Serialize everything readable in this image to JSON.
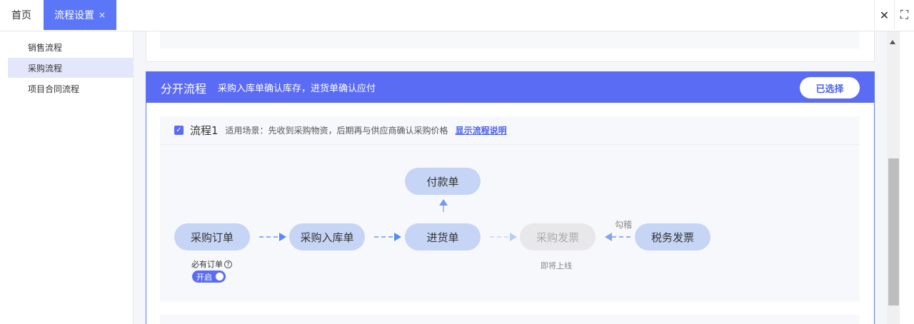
{
  "tabs": {
    "home_label": "首页",
    "active_label": "流程设置",
    "active_close": "×"
  },
  "topbar_icons": [
    "close-icon",
    "fullscreen-icon"
  ],
  "topbar_glyphs": {
    "close": "✕",
    "fullscreen": "⛶"
  },
  "sidebar": {
    "items": [
      {
        "label": "销售流程",
        "active": false
      },
      {
        "label": "采购流程",
        "active": true
      },
      {
        "label": "项目合同流程",
        "active": false
      }
    ]
  },
  "card": {
    "title": "分开流程",
    "subtitle": "采购入库单确认库存，进货单确认应付",
    "selected_button": "已选择"
  },
  "flow": {
    "checkbox_checked": true,
    "checkbox_glyph": "✓",
    "name": "流程1",
    "description": "适用场景：先收到采购物资，后期再与供应商确认采购价格",
    "link": "显示流程说明",
    "nodes": {
      "payment": "付款单",
      "purchase_order": "采购订单",
      "purchase_inbound": "采购入库单",
      "goods_receipt": "进货单",
      "purchase_invoice": "采购发票",
      "tax_invoice": "税务发票"
    },
    "required_order_label": "必有订单",
    "help_glyph": "?",
    "toggle_label": "开启",
    "toggle_on": true,
    "coming_soon": "即将上线",
    "reconcile_label": "勾稽"
  },
  "colors": {
    "accent": "#5b6cf4",
    "tab_active": "#5b76f7",
    "node": "#c6d4f5",
    "node_disabled": "#e8e8ea"
  }
}
